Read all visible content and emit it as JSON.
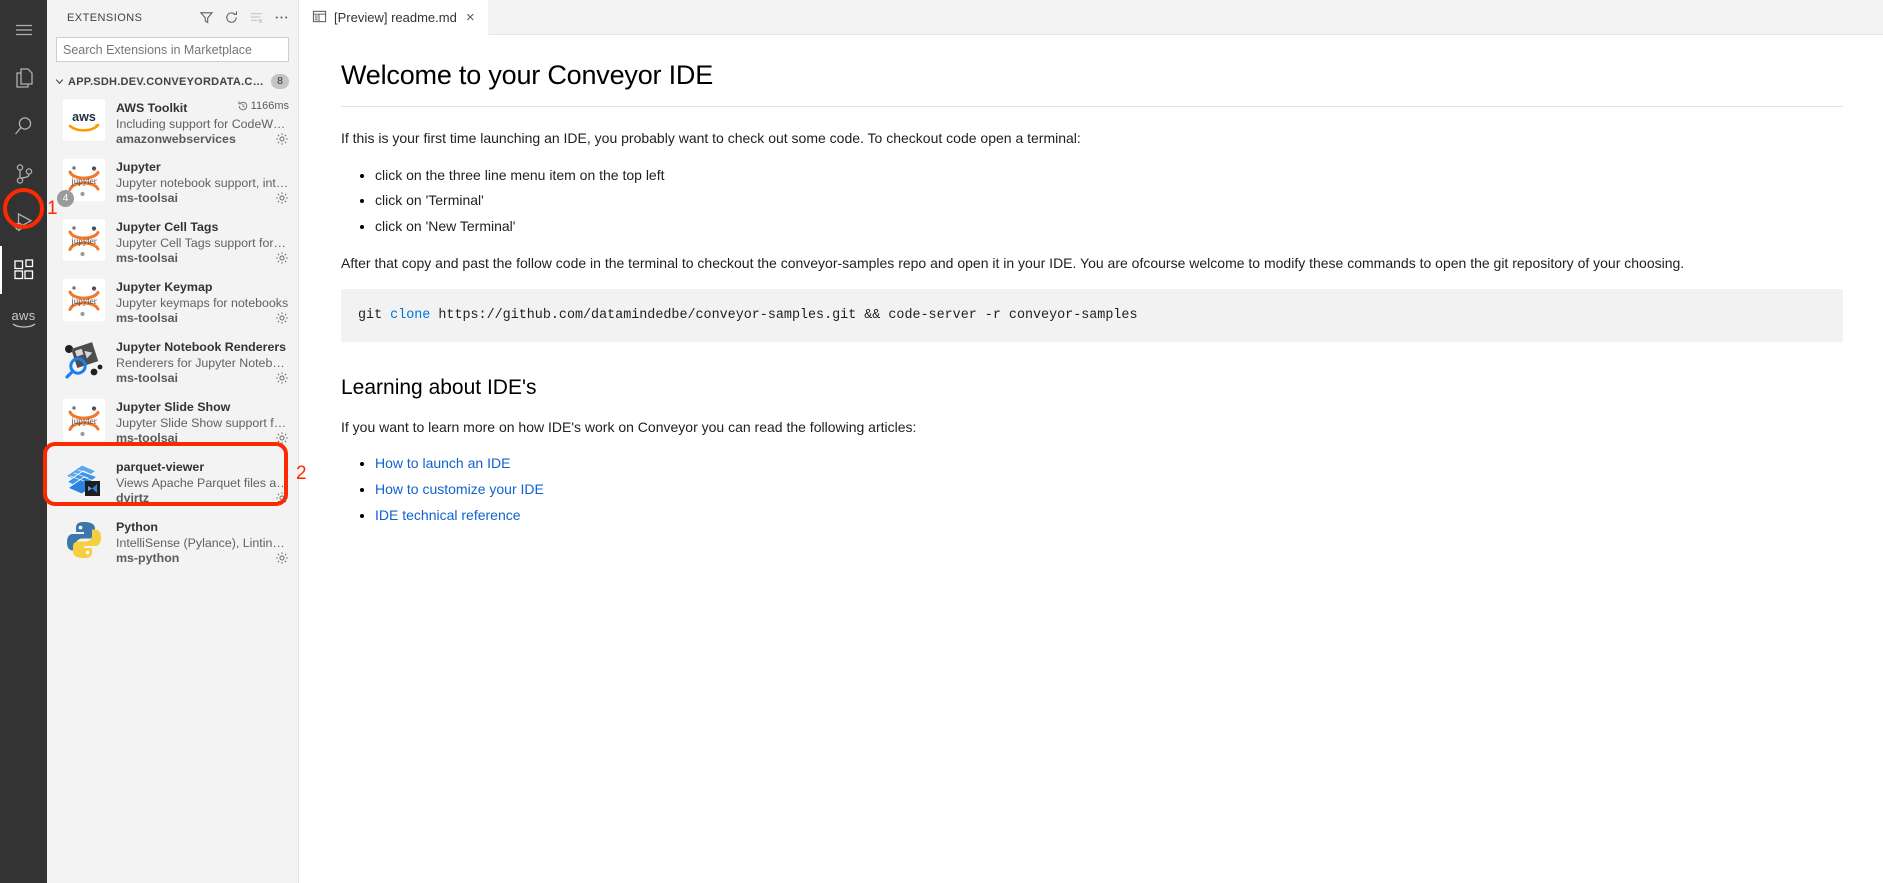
{
  "activity_bar": {
    "items": [
      {
        "name": "menu",
        "label": "Menu"
      },
      {
        "name": "explorer",
        "label": "Explorer"
      },
      {
        "name": "search",
        "label": "Search"
      },
      {
        "name": "source-control",
        "label": "Source Control"
      },
      {
        "name": "run-debug",
        "label": "Run and Debug"
      },
      {
        "name": "extensions",
        "label": "Extensions"
      },
      {
        "name": "aws",
        "label": "aws"
      }
    ],
    "active": "extensions"
  },
  "sidebar": {
    "title": "EXTENSIONS",
    "actions": [
      {
        "name": "filter-icon",
        "label": "Filter Extensions"
      },
      {
        "name": "refresh-icon",
        "label": "Refresh"
      },
      {
        "name": "clear-list-icon",
        "label": "Clear Extensions Search Results"
      },
      {
        "name": "more-actions-icon",
        "label": "Views and More Actions..."
      }
    ],
    "search": {
      "placeholder": "Search Extensions in Marketplace",
      "value": ""
    },
    "section": {
      "label": "APP.SDH.DEV.CONVEYORDATA.COM - INS...",
      "count": "8",
      "expanded": true
    },
    "extensions": [
      {
        "name": "AWS Toolkit",
        "description": "Including support for CodeWhisp...",
        "publisher": "amazonwebservices",
        "timing": "1166ms",
        "icon": "aws-logo",
        "badge": "",
        "gear": true
      },
      {
        "name": "Jupyter",
        "description": "Jupyter notebook support, interac...",
        "publisher": "ms-toolsai",
        "timing": "",
        "icon": "jupyter-logo",
        "badge": "4",
        "gear": true
      },
      {
        "name": "Jupyter Cell Tags",
        "description": "Jupyter Cell Tags support for VS ...",
        "publisher": "ms-toolsai",
        "timing": "",
        "icon": "jupyter-logo",
        "badge": "",
        "gear": true
      },
      {
        "name": "Jupyter Keymap",
        "description": "Jupyter keymaps for notebooks",
        "publisher": "ms-toolsai",
        "timing": "",
        "icon": "jupyter-logo",
        "badge": "",
        "gear": true
      },
      {
        "name": "Jupyter Notebook Renderers",
        "description": "Renderers for Jupyter Notebooks ...",
        "publisher": "ms-toolsai",
        "timing": "",
        "icon": "notebook-renderers-logo",
        "badge": "",
        "gear": true
      },
      {
        "name": "Jupyter Slide Show",
        "description": "Jupyter Slide Show support for V...",
        "publisher": "ms-toolsai",
        "timing": "",
        "icon": "jupyter-logo",
        "badge": "",
        "gear": true
      },
      {
        "name": "parquet-viewer",
        "description": "Views Apache Parquet files as JS...",
        "publisher": "dvirtz",
        "timing": "",
        "icon": "parquet-logo",
        "badge": "",
        "gear": true
      },
      {
        "name": "Python",
        "description": "IntelliSense (Pylance), Linting, De...",
        "publisher": "ms-python",
        "timing": "",
        "icon": "python-logo",
        "badge": "",
        "gear": true
      }
    ]
  },
  "editor": {
    "tab": {
      "label": "[Preview] readme.md",
      "close": "×",
      "icon": "preview-icon"
    }
  },
  "document": {
    "title": "Welcome to your Conveyor IDE",
    "intro": "If this is your first time launching an IDE, you probably want to check out some code. To checkout code open a terminal:",
    "steps": [
      "click on the three line menu item on the top left",
      "click on 'Terminal'",
      "click on 'New Terminal'"
    ],
    "after_text": "After that copy and past the follow code in the terminal to checkout the conveyor-samples repo and open it in your IDE. You are ofcourse welcome to modify these commands to open the git repository of your choosing.",
    "code": {
      "cmd": "git ",
      "kw": "clone",
      "rest": " https://github.com/datamindedbe/conveyor-samples.git && code-server -r conveyor-samples"
    },
    "section2_title": "Learning about IDE's",
    "section2_intro": "If you want to learn more on how IDE's work on Conveyor you can read the following articles:",
    "links": [
      "How to launch an IDE",
      "How to customize your IDE",
      "IDE technical reference"
    ]
  },
  "annotations": {
    "color": "#fc2a00",
    "items": [
      {
        "label": "1",
        "target": "extensions-activity-icon"
      },
      {
        "label": "2",
        "target": "parquet-viewer-extension-item"
      }
    ]
  }
}
